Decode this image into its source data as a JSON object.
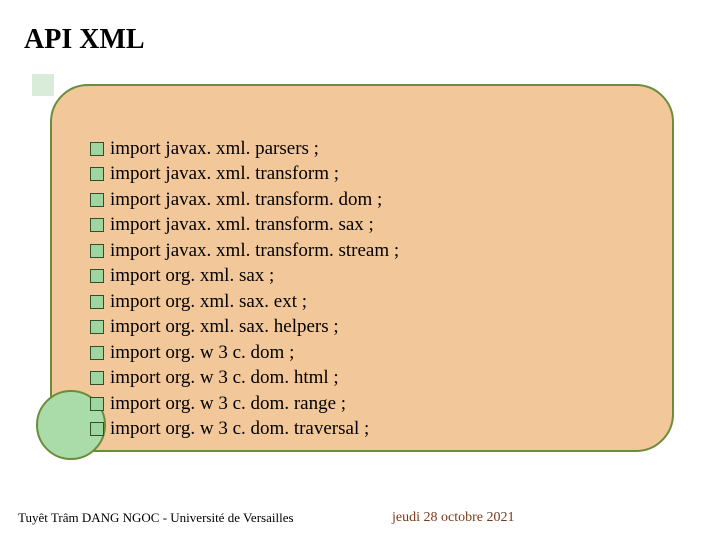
{
  "title": "API XML",
  "items": [
    "import javax. xml. parsers ;",
    "import javax. xml. transform ;",
    "import javax. xml. transform. dom ;",
    "import javax. xml. transform. sax ;",
    "import javax. xml. transform. stream ;",
    "import org. xml. sax ;",
    "import org. xml. sax. ext ;",
    "import org. xml. sax. helpers ;",
    "import org. w 3 c. dom ;",
    "import org. w 3 c. dom. html ;",
    "import org. w 3 c. dom. range ;",
    "import org. w 3 c. dom. traversal ;"
  ],
  "footer": {
    "left": "Tuyêt Trâm DANG NGOC - Université de Versailles",
    "right": "jeudi 28 octobre 2021"
  }
}
